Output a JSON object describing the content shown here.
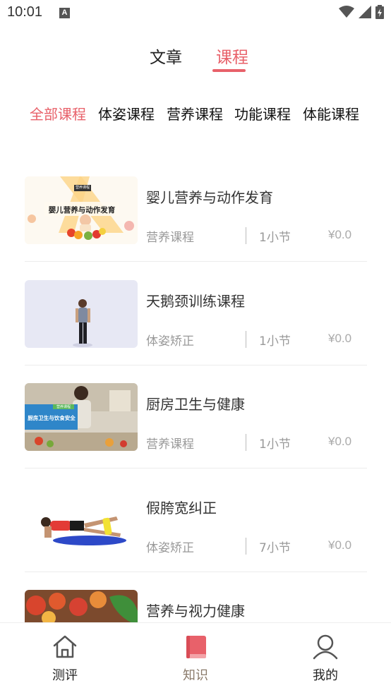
{
  "status_bar": {
    "time": "10:01",
    "notification_icon": "a-icon"
  },
  "top_tabs": [
    {
      "label": "文章",
      "active": false
    },
    {
      "label": "课程",
      "active": true
    }
  ],
  "categories": [
    {
      "label": "全部课程",
      "active": true
    },
    {
      "label": "体姿课程",
      "active": false
    },
    {
      "label": "营养课程",
      "active": false
    },
    {
      "label": "功能课程",
      "active": false
    },
    {
      "label": "体能课程",
      "active": false
    }
  ],
  "courses": [
    {
      "title": "婴儿营养与动作发育",
      "category": "营养课程",
      "lessons": "1小节",
      "price": "¥0.0",
      "thumb_tag": "营养课程",
      "thumb_text": "婴儿营养与动作发育"
    },
    {
      "title": "天鹅颈训练课程",
      "category": "体姿矫正",
      "lessons": "1小节",
      "price": "¥0.0"
    },
    {
      "title": "厨房卫生与健康",
      "category": "营养课程",
      "lessons": "1小节",
      "price": "¥0.0",
      "thumb_tag": "营养课程",
      "thumb_text": "厨房卫生与饮食安全"
    },
    {
      "title": "假胯宽纠正",
      "category": "体姿矫正",
      "lessons": "7小节",
      "price": "¥0.0"
    },
    {
      "title": "营养与视力健康"
    }
  ],
  "bottom_nav": [
    {
      "label": "测评",
      "icon": "home-icon",
      "active": false
    },
    {
      "label": "知识",
      "icon": "book-icon",
      "active": true
    },
    {
      "label": "我的",
      "icon": "user-icon",
      "active": false
    }
  ],
  "colors": {
    "accent": "#e8616a",
    "muted": "#999999"
  }
}
